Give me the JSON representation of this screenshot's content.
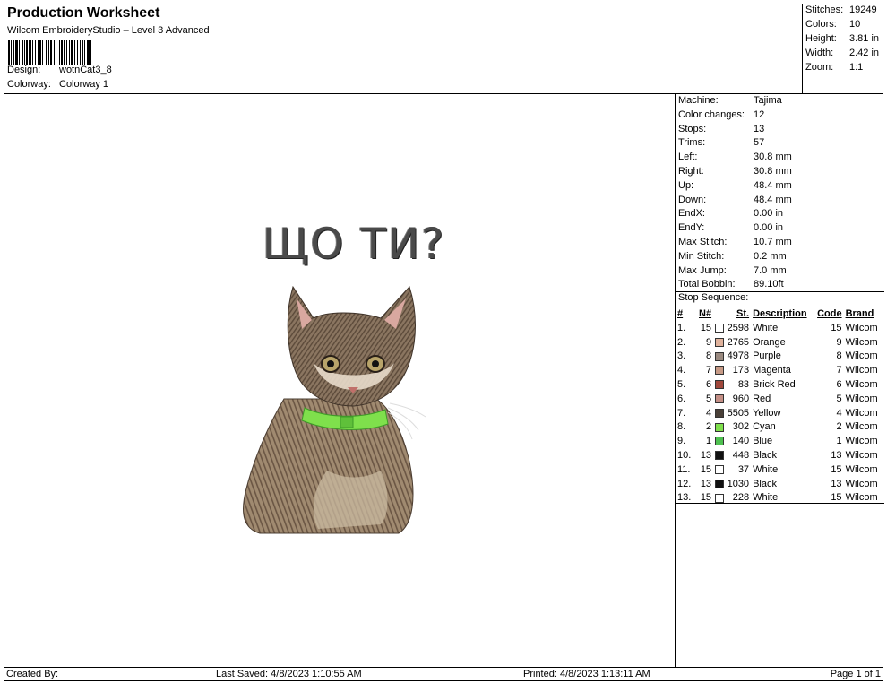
{
  "header": {
    "title": "Production Worksheet",
    "subtitle": "Wilcom EmbroideryStudio – Level 3 Advanced",
    "design_label": "Design:",
    "design_value": "wotnCat3_8",
    "colorway_label": "Colorway:",
    "colorway_value": "Colorway 1"
  },
  "summary": {
    "stitches_label": "Stitches:",
    "stitches": "19249",
    "colors_label": "Colors:",
    "colors": "10",
    "height_label": "Height:",
    "height": "3.81 in",
    "width_label": "Width:",
    "width": "2.42 in",
    "zoom_label": "Zoom:",
    "zoom": "1:1"
  },
  "design": {
    "text": "ЩО ТИ?"
  },
  "machine_info": [
    {
      "k": "Machine:",
      "v": "Tajima"
    },
    {
      "k": "Color changes:",
      "v": "12"
    },
    {
      "k": "Stops:",
      "v": "13"
    },
    {
      "k": "Trims:",
      "v": "57"
    },
    {
      "k": "Left:",
      "v": "30.8 mm"
    },
    {
      "k": "Right:",
      "v": "30.8 mm"
    },
    {
      "k": "Up:",
      "v": "48.4 mm"
    },
    {
      "k": "Down:",
      "v": "48.4 mm"
    },
    {
      "k": "EndX:",
      "v": "0.00 in"
    },
    {
      "k": "EndY:",
      "v": "0.00 in"
    },
    {
      "k": "Max Stitch:",
      "v": "10.7 mm"
    },
    {
      "k": "Min Stitch:",
      "v": "0.2 mm"
    },
    {
      "k": "Max Jump:",
      "v": "7.0 mm"
    },
    {
      "k": "Total Bobbin:",
      "v": "89.10ft"
    }
  ],
  "stop_sequence": {
    "title": "Stop Sequence:",
    "headers": [
      "#",
      "N#",
      "St.",
      "Description",
      "Code",
      "Brand"
    ],
    "rows": [
      {
        "idx": "1.",
        "n": "15",
        "color": "#ffffff",
        "st": "2598",
        "desc": "White",
        "code": "15",
        "brand": "Wilcom"
      },
      {
        "idx": "2.",
        "n": "9",
        "color": "#e0b29c",
        "st": "2765",
        "desc": "Orange",
        "code": "9",
        "brand": "Wilcom"
      },
      {
        "idx": "3.",
        "n": "8",
        "color": "#9a8a80",
        "st": "4978",
        "desc": "Purple",
        "code": "8",
        "brand": "Wilcom"
      },
      {
        "idx": "4.",
        "n": "7",
        "color": "#c79a86",
        "st": "173",
        "desc": "Magenta",
        "code": "7",
        "brand": "Wilcom"
      },
      {
        "idx": "5.",
        "n": "6",
        "color": "#a0473b",
        "st": "83",
        "desc": "Brick Red",
        "code": "6",
        "brand": "Wilcom"
      },
      {
        "idx": "6.",
        "n": "5",
        "color": "#c48f86",
        "st": "960",
        "desc": "Red",
        "code": "5",
        "brand": "Wilcom"
      },
      {
        "idx": "7.",
        "n": "4",
        "color": "#4a4038",
        "st": "5505",
        "desc": "Yellow",
        "code": "4",
        "brand": "Wilcom"
      },
      {
        "idx": "8.",
        "n": "2",
        "color": "#7fe04c",
        "st": "302",
        "desc": "Cyan",
        "code": "2",
        "brand": "Wilcom"
      },
      {
        "idx": "9.",
        "n": "1",
        "color": "#4ec050",
        "st": "140",
        "desc": "Blue",
        "code": "1",
        "brand": "Wilcom"
      },
      {
        "idx": "10.",
        "n": "13",
        "color": "#111111",
        "st": "448",
        "desc": "Black",
        "code": "13",
        "brand": "Wilcom"
      },
      {
        "idx": "11.",
        "n": "15",
        "color": "#ffffff",
        "st": "37",
        "desc": "White",
        "code": "15",
        "brand": "Wilcom"
      },
      {
        "idx": "12.",
        "n": "13",
        "color": "#111111",
        "st": "1030",
        "desc": "Black",
        "code": "13",
        "brand": "Wilcom"
      },
      {
        "idx": "13.",
        "n": "15",
        "color": "#ffffff",
        "st": "228",
        "desc": "White",
        "code": "15",
        "brand": "Wilcom"
      }
    ]
  },
  "footer": {
    "created_by": "Created By:",
    "last_saved": "Last Saved: 4/8/2023 1:10:55 AM",
    "printed": "Printed: 4/8/2023 1:13:11 AM",
    "page": "Page 1 of 1"
  }
}
